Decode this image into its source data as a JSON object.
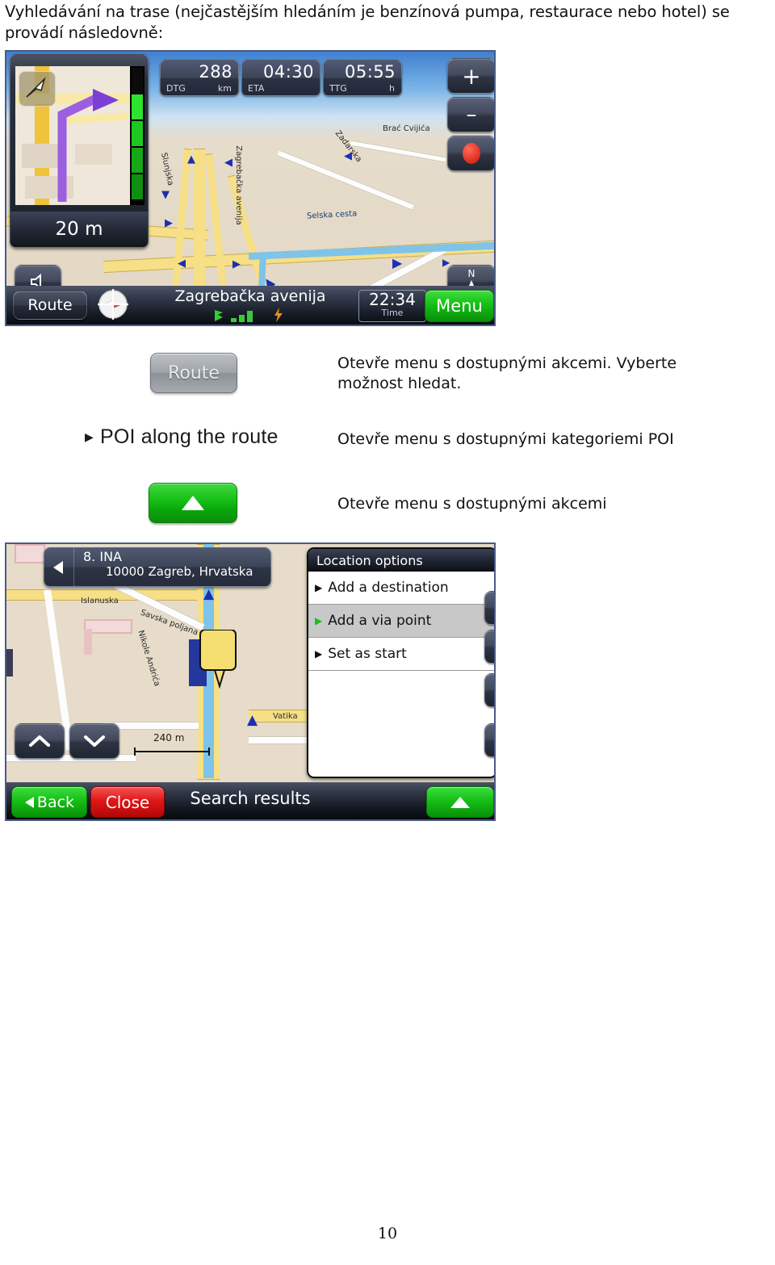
{
  "document": {
    "intro_paragraph": "Vyhledávání na trase  (nejčastějším hledáním je benzínová pumpa, restaurace nebo hotel) se provádí následovně:",
    "page_number": "10"
  },
  "screen1": {
    "name": "navigation-map-screen",
    "turn_preview": {
      "distance": "20 m"
    },
    "data_boxes": [
      {
        "value": "288",
        "label": "DTG",
        "unit": "km"
      },
      {
        "value": "04:30",
        "label": "ETA",
        "unit": ""
      },
      {
        "value": "05:55",
        "label": "TTG",
        "unit": "h"
      }
    ],
    "zoom_in_label": "+",
    "zoom_out_label": "–",
    "record_label": "",
    "north_label": "N",
    "streets": [
      "Slunjska",
      "Brać Cvijića",
      "Zadarska",
      "Selska cesta",
      "lska cesta",
      "Zagrebačka avenija"
    ],
    "scale_label": "20 m",
    "bottom_bar": {
      "route_label": "Route",
      "road_name": "Zagrebačka avenija",
      "clock_time": "22:34",
      "clock_label": "Time",
      "menu_label": "Menu"
    }
  },
  "legend_rows": [
    {
      "control": "route-button",
      "control_label": "Route",
      "description": "Otevře menu s dostupnými akcemi. Vyberte možnost hledat."
    },
    {
      "control": "poi-along-route-item",
      "control_label": "POI along the route",
      "description": "Otevře menu s dostupnými kategoriemi POI"
    },
    {
      "control": "green-up-button",
      "control_label": "",
      "description": "Otevře menu s dostupnými akcemi"
    }
  ],
  "screen2": {
    "name": "search-results-map-screen",
    "poi_bubble": {
      "index_name": "8. INA",
      "address": "10000 Zagreb, Hrvatska"
    },
    "context_menu": {
      "title": "Location options",
      "items": [
        {
          "label": "Add a destination",
          "selected": false
        },
        {
          "label": "Add a via point",
          "selected": true
        },
        {
          "label": "Set as start",
          "selected": false
        }
      ]
    },
    "streets": [
      "Islanuska",
      "Savska poljana",
      "Nikole Andrića",
      "Vatika"
    ],
    "scale_label": "240 m",
    "bottom_bar": {
      "back_label": "Back",
      "close_label": "Close",
      "title": "Search results"
    }
  },
  "colors": {
    "green": "#19c219",
    "red": "#e01717",
    "map_land": "#e6dcc9",
    "road_yellow": "#f6df86",
    "river_blue": "#7fc3e8",
    "panel_dark": "#2d3444"
  }
}
